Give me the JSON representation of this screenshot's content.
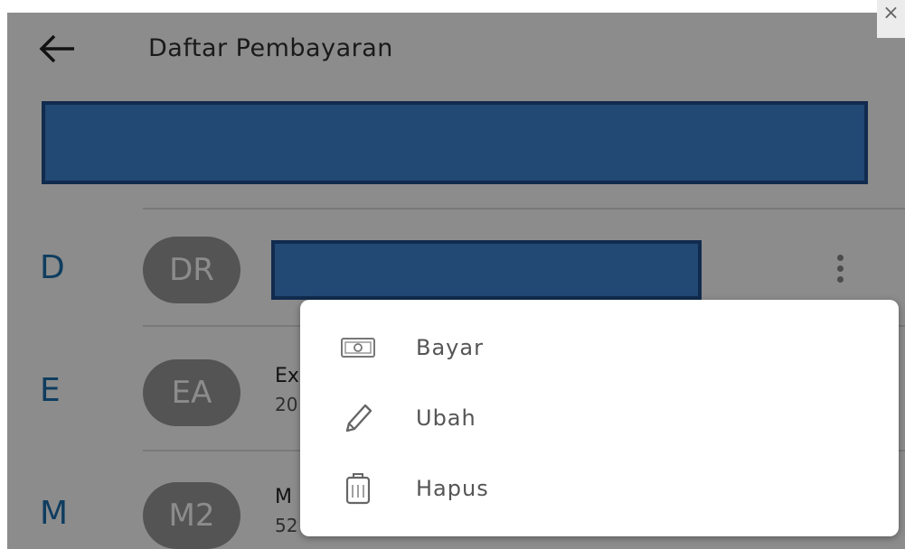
{
  "app_bar": {
    "title": "Daftar Pembayaran"
  },
  "list": {
    "sections": [
      {
        "letter": "D",
        "avatar": "DR",
        "title": "",
        "subtitle": ""
      },
      {
        "letter": "E",
        "avatar": "EA",
        "title": "Ex",
        "subtitle": "20"
      },
      {
        "letter": "M",
        "avatar": "M2",
        "title": "M",
        "subtitle": "52"
      }
    ]
  },
  "menu": {
    "items": [
      {
        "label": "Bayar",
        "icon": "money-icon"
      },
      {
        "label": "Ubah",
        "icon": "pencil-icon"
      },
      {
        "label": "Hapus",
        "icon": "trash-icon"
      }
    ]
  },
  "window": {
    "close_glyph": "×"
  },
  "colors": {
    "accent": "#1d6fae",
    "redaction": "#3f83d3"
  }
}
